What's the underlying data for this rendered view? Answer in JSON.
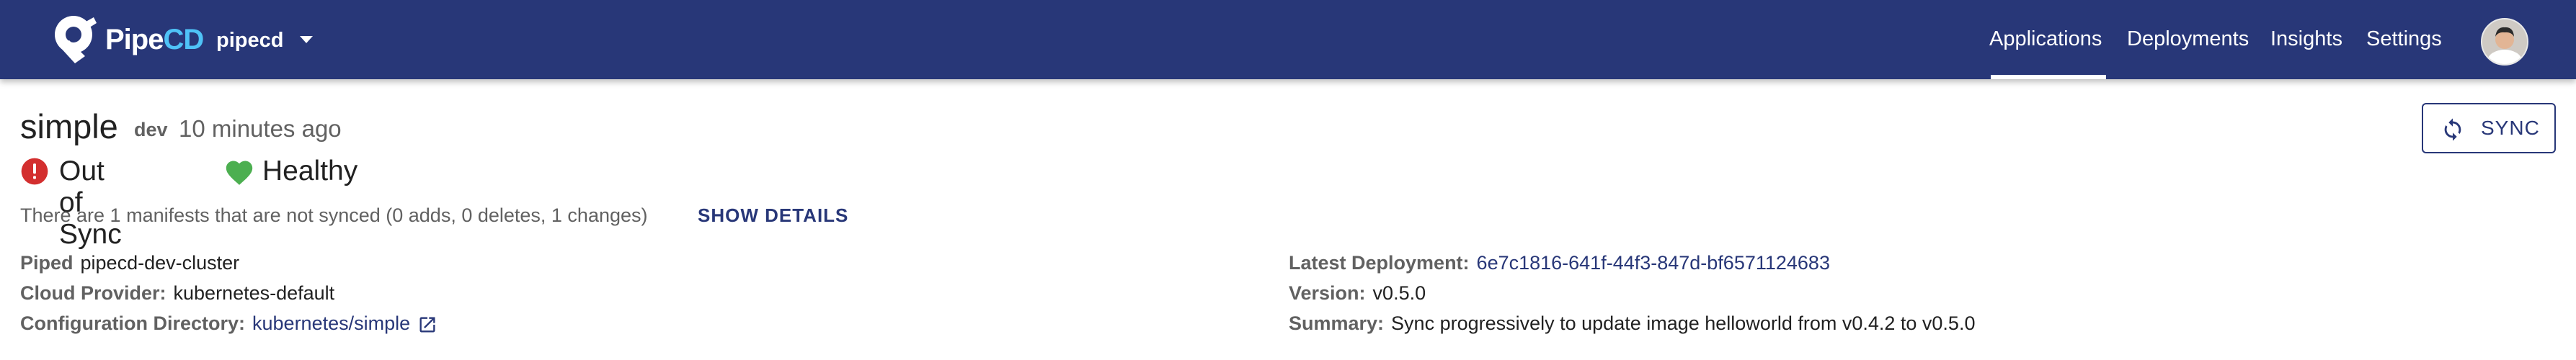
{
  "header": {
    "brand_main": "Pipe",
    "brand_accent": "CD",
    "project": "pipecd",
    "nav": [
      "Applications",
      "Deployments",
      "Insights",
      "Settings"
    ],
    "active_nav": "Applications",
    "colors": {
      "bar": "#283778",
      "brand_accent": "#4fc3f7"
    },
    "icons": {
      "logo": "pipecd-logo-icon",
      "project_menu": "caret-down-icon",
      "user": "avatar"
    }
  },
  "application": {
    "name": "simple",
    "env": "dev",
    "updated": "10 minutes ago",
    "sync_status": "Out of Sync",
    "health_status": "Healthy",
    "status_colors": {
      "out_of_sync": "#d32f2f",
      "healthy": "#4caf50"
    },
    "manifest_message": "There are 1 manifests that are not synced (0 adds, 0 deletes, 1 changes)",
    "show_details_label": "SHOW DETAILS",
    "sync_button_label": "SYNC"
  },
  "details": {
    "piped_label": "Piped",
    "piped_value": "pipecd-dev-cluster",
    "cloud_provider_label": "Cloud Provider:",
    "cloud_provider_value": "kubernetes-default",
    "config_dir_label": "Configuration Directory:",
    "config_dir_value": "kubernetes/simple",
    "latest_deployment_label": "Latest Deployment:",
    "latest_deployment_value": "6e7c1816-641f-44f3-847d-bf6571124683",
    "version_label": "Version:",
    "version_value": "v0.5.0",
    "summary_label": "Summary:",
    "summary_value": "Sync progressively to update image helloworld from v0.4.2 to v0.5.0"
  }
}
